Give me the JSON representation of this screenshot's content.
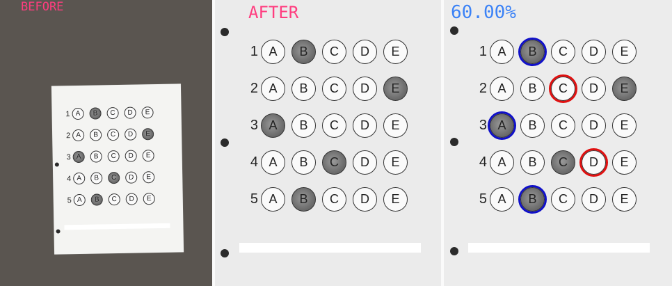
{
  "panels": {
    "before_label": "BEFORE",
    "after_label": "AFTER",
    "score_label": "60.00%"
  },
  "choices": [
    "A",
    "B",
    "C",
    "D",
    "E"
  ],
  "questions": [
    {
      "number": "1",
      "filled": "B",
      "correct": "B"
    },
    {
      "number": "2",
      "filled": "E",
      "correct": "C"
    },
    {
      "number": "3",
      "filled": "A",
      "correct": "A"
    },
    {
      "number": "4",
      "filled": "C",
      "correct": "D"
    },
    {
      "number": "5",
      "filled": "B",
      "correct": "B"
    }
  ],
  "colors": {
    "label_pink": "#ff3d7f",
    "score_blue": "#3b82f6",
    "correct_circle": "#1010c8",
    "wrong_circle": "#e01010"
  }
}
